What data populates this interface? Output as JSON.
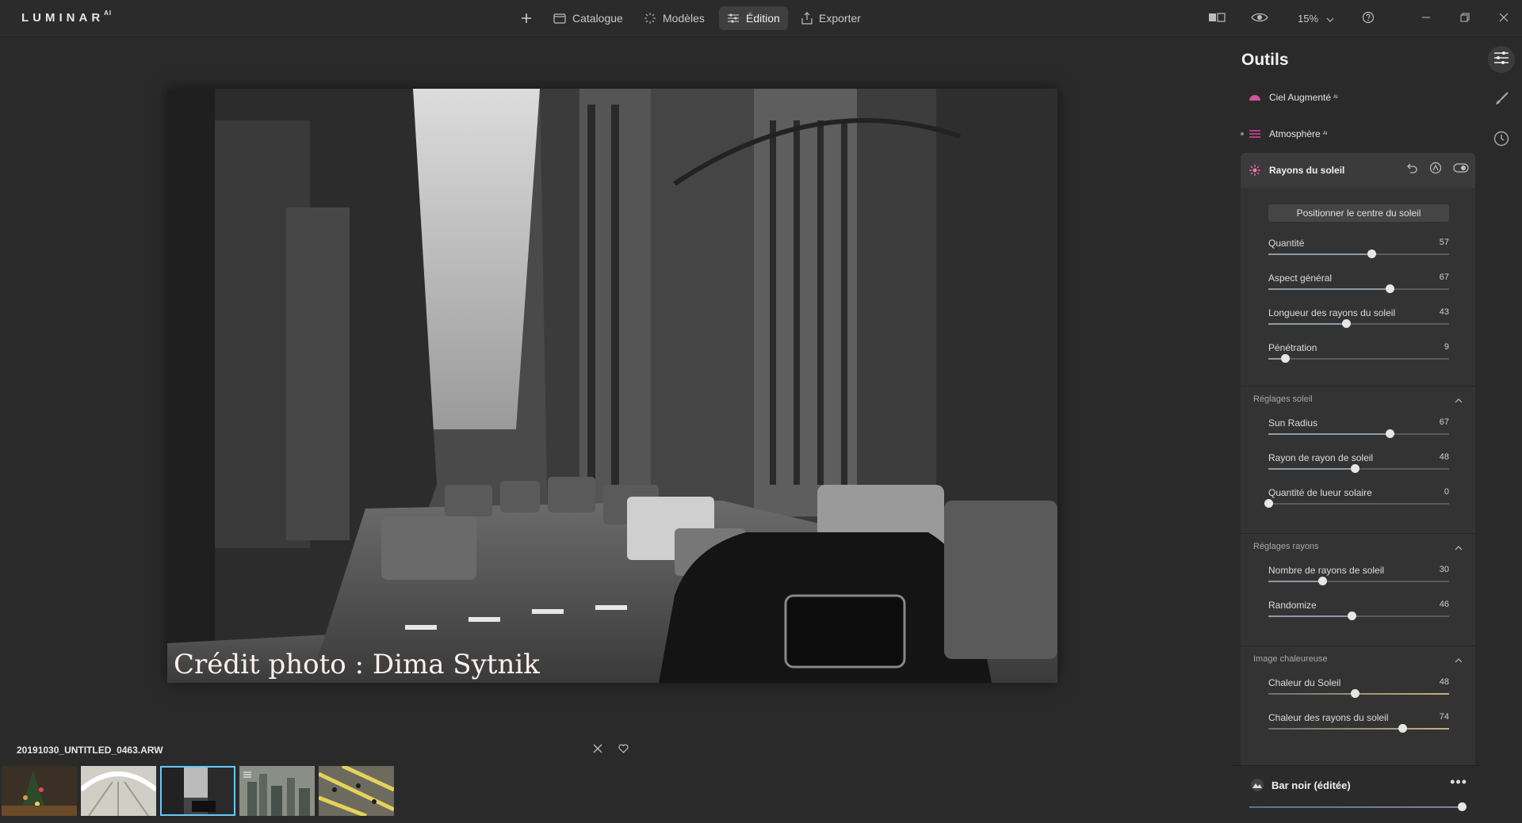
{
  "app": {
    "logo": "LUMINAR",
    "logo_suffix": "AI"
  },
  "topbar": {
    "nav": [
      {
        "label": "Catalogue",
        "icon": "catalog-icon"
      },
      {
        "label": "Modèles",
        "icon": "templates-icon"
      },
      {
        "label": "Édition",
        "icon": "edit-sliders-icon",
        "active": true
      },
      {
        "label": "Exporter",
        "icon": "export-icon"
      }
    ],
    "zoom": "15%"
  },
  "photo": {
    "credit": "Crédit photo : Dima Sytnik"
  },
  "filmstrip": {
    "filename": "20191030_UNTITLED_0463.ARW",
    "selected_index": 2,
    "count": 5
  },
  "panel": {
    "title": "Outils",
    "tools": [
      {
        "label": "Ciel Augmenté",
        "ai": "AI",
        "icon": "sky-icon"
      },
      {
        "label": "Atmosphère",
        "ai": "AI",
        "icon": "atmosphere-icon"
      }
    ],
    "sunrays": {
      "title": "Rayons du soleil",
      "position_button": "Positionner le centre du soleil",
      "sliders": [
        {
          "label": "Quantité",
          "value": 57,
          "pct": 0.57
        },
        {
          "label": "Aspect général",
          "value": 67,
          "pct": 0.67
        },
        {
          "label": "Longueur des rayons du soleil",
          "value": 43,
          "pct": 0.43
        },
        {
          "label": "Pénétration",
          "value": 9,
          "pct": 0.09
        }
      ],
      "sections": [
        {
          "title": "Réglages soleil",
          "sliders": [
            {
              "label": "Sun Radius",
              "value": 67,
              "pct": 0.67
            },
            {
              "label": "Rayon de rayon de soleil",
              "value": 48,
              "pct": 0.48
            },
            {
              "label": "Quantité de lueur solaire",
              "value": 0,
              "pct": 0.0
            }
          ]
        },
        {
          "title": "Réglages rayons",
          "sliders": [
            {
              "label": "Nombre de rayons de soleil",
              "value": 30,
              "pct": 0.3
            },
            {
              "label": "Randomize",
              "value": 46,
              "pct": 0.46
            }
          ]
        },
        {
          "title": "Image chaleureuse",
          "warm": true,
          "sliders": [
            {
              "label": "Chaleur du Soleil",
              "value": 48,
              "pct": 0.48
            },
            {
              "label": "Chaleur des rayons du soleil",
              "value": 74,
              "pct": 0.74
            }
          ]
        }
      ]
    },
    "preset": {
      "name": "Bar noir (éditée)",
      "amount_pct": 1.0,
      "more": "•••"
    }
  },
  "colors": {
    "accent": "#66c8ff",
    "sky_icon": "#d0559a",
    "atmosphere_icon": "#e0459a",
    "sunrays_icon": "#ff6fb3"
  }
}
